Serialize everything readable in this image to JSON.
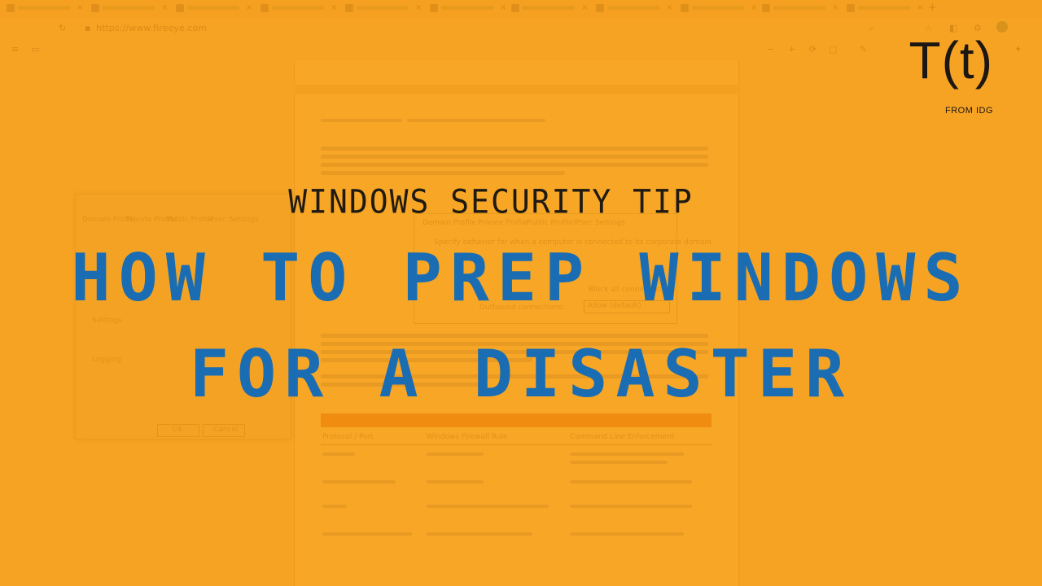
{
  "browser": {
    "url_prefix": "https://www.fireeye.com"
  },
  "dialog": {
    "tabs": [
      "Domain Profile",
      "Private Profile",
      "Public Profile",
      "IPsec Settings"
    ],
    "settings_label": "Settings",
    "logging_label": "Logging",
    "ok_label": "OK",
    "cancel_label": "Cancel"
  },
  "doc_dialog": {
    "tabs": [
      "Domain Profile",
      "Private Profile",
      "Public Profile",
      "IPsec Settings"
    ],
    "intro": "Specify behavior for when a computer is connected to its corporate domain.",
    "outbound_label": "Outbound connections:",
    "outbound_value": "Allow (default)",
    "inbound_value": "Block all connections"
  },
  "doc_table": {
    "headers": [
      "Protocol / Port",
      "Windows Firewall Rule",
      "Command Line Enforcement"
    ]
  },
  "logo": {
    "mark": "T(t)",
    "sub": "FROM IDG"
  },
  "headline": {
    "kicker": "WINDOWS SECURITY TIP",
    "line1": "HOW TO PREP WINDOWS",
    "line2": "FOR A DISASTER"
  },
  "colors": {
    "background": "#f6a324",
    "title": "#1a6db3",
    "kicker": "#1f1a12"
  }
}
